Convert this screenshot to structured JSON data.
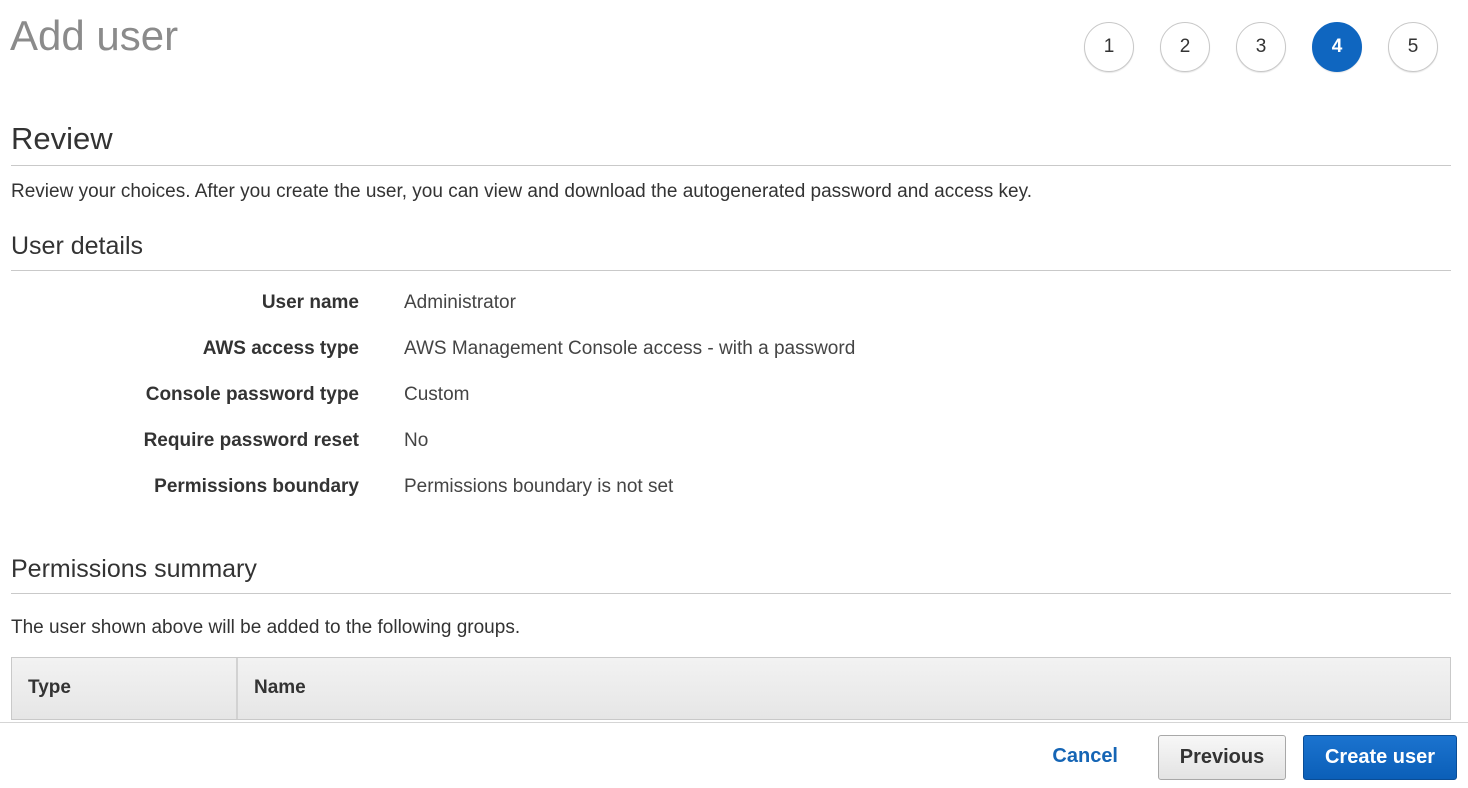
{
  "page": {
    "title": "Add user"
  },
  "steps": [
    {
      "label": "1",
      "active": false
    },
    {
      "label": "2",
      "active": false
    },
    {
      "label": "3",
      "active": false
    },
    {
      "label": "4",
      "active": true
    },
    {
      "label": "5",
      "active": false
    }
  ],
  "review": {
    "heading": "Review",
    "description": "Review your choices. After you create the user, you can view and download the autogenerated password and access key."
  },
  "user_details": {
    "heading": "User details",
    "rows": [
      {
        "label": "User name",
        "value": "Administrator"
      },
      {
        "label": "AWS access type",
        "value": "AWS Management Console access - with a password"
      },
      {
        "label": "Console password type",
        "value": "Custom"
      },
      {
        "label": "Require password reset",
        "value": "No"
      },
      {
        "label": "Permissions boundary",
        "value": "Permissions boundary is not set"
      }
    ]
  },
  "permissions_summary": {
    "heading": "Permissions summary",
    "description": "The user shown above will be added to the following groups.",
    "columns": [
      "Type",
      "Name"
    ]
  },
  "footer": {
    "cancel_label": "Cancel",
    "previous_label": "Previous",
    "create_label": "Create user"
  },
  "colors": {
    "accent": "#0f66c0",
    "link": "#1565b5"
  }
}
